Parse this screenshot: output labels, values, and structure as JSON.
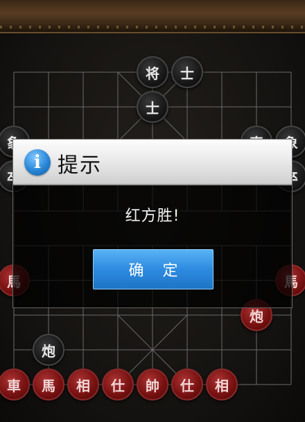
{
  "dialog": {
    "title": "提示",
    "message": "红方胜!",
    "ok_label": "确 定",
    "info_glyph": "i"
  },
  "board": {
    "black_pieces": [
      {
        "label": "将",
        "col": 4,
        "row": 0
      },
      {
        "label": "士",
        "col": 5,
        "row": 0
      },
      {
        "label": "士",
        "col": 4,
        "row": 1
      },
      {
        "label": "象",
        "col": 0,
        "row": 2
      },
      {
        "label": "車",
        "col": 7,
        "row": 2
      },
      {
        "label": "象",
        "col": 8,
        "row": 2
      },
      {
        "label": "卒",
        "col": 0,
        "row": 3
      },
      {
        "label": "卒",
        "col": 8,
        "row": 3
      },
      {
        "label": "炮",
        "col": 1,
        "row": 8
      }
    ],
    "red_pieces": [
      {
        "label": "馬",
        "col": 0,
        "row": 6
      },
      {
        "label": "馬",
        "col": 8,
        "row": 6
      },
      {
        "label": "炮",
        "col": 7,
        "row": 7
      },
      {
        "label": "車",
        "col": 0,
        "row": 9
      },
      {
        "label": "馬",
        "col": 1,
        "row": 9
      },
      {
        "label": "相",
        "col": 2,
        "row": 9
      },
      {
        "label": "仕",
        "col": 3,
        "row": 9
      },
      {
        "label": "帥",
        "col": 4,
        "row": 9
      },
      {
        "label": "仕",
        "col": 5,
        "row": 9
      },
      {
        "label": "相",
        "col": 6,
        "row": 9
      }
    ]
  },
  "colors": {
    "accent": "#2d8be0",
    "red_piece": "#7a1212",
    "black_piece": "#1a1a1a",
    "board_line": "#6a6a6a"
  }
}
